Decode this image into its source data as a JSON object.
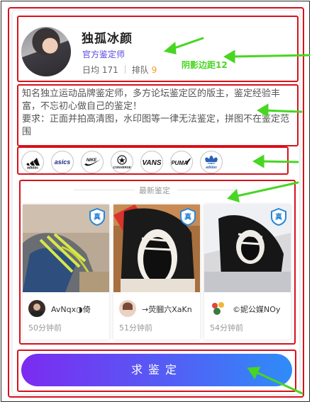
{
  "profile": {
    "name": "独孤冰颜",
    "role": "官方鉴定师",
    "daily_avg": "日均 171",
    "queue_label": "排队",
    "queue_count": "9"
  },
  "annotation": {
    "margin_note": "阴影边距12"
  },
  "description": {
    "line1": "知名独立运动品牌鉴定师，多方论坛鉴定区的版主，鉴定经验丰富，不忘初心做自己的鉴定！",
    "line2": "要求：正面并拍高清图，水印图等一律无法鉴定，拼图不在鉴定范围"
  },
  "brands": [
    {
      "name": "adidas",
      "icon": "adidas-logo"
    },
    {
      "name": "asics",
      "icon": "asics-logo"
    },
    {
      "name": "nike",
      "icon": "nike-logo"
    },
    {
      "name": "converse",
      "icon": "converse-logo"
    },
    {
      "name": "VANS",
      "icon": "vans-logo"
    },
    {
      "name": "PUMA",
      "icon": "puma-logo"
    },
    {
      "name": "adidas",
      "icon": "adidas-originals-logo"
    }
  ],
  "latest": {
    "title": "最新鉴定",
    "badge_label": "真",
    "items": [
      {
        "user": "AvNqx◑倚",
        "time": "50分钟前"
      },
      {
        "user": "→荧膕六XaKn",
        "time": "51分钟前"
      },
      {
        "user": "©妮公媒NOy",
        "time": "54分钟前"
      }
    ]
  },
  "cta": {
    "label": "求鉴定"
  },
  "colors": {
    "accent_red": "#d8111b",
    "cta_start": "#7c2bf0",
    "cta_end": "#2f8cf8",
    "role": "#5a4ae0",
    "annotation_green": "#47d622"
  }
}
